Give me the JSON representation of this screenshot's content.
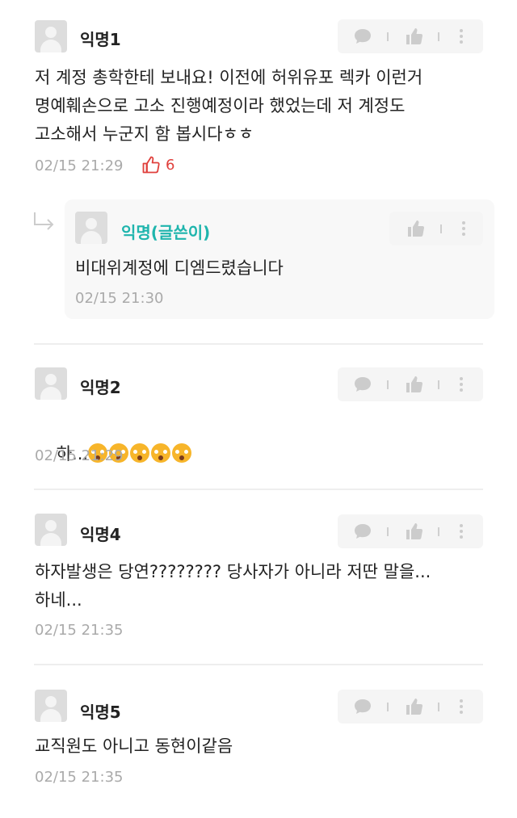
{
  "comments": [
    {
      "author": "익명1",
      "lines": [
        "저 계정 총학한테 보내요! 이전에 허위유포 렉카 이런거",
        "명예훼손으로 고소 진행예정이라 했었는데 저 계정도",
        "고소해서 누군지 함 봅시다ㅎㅎ"
      ],
      "time": "02/15 21:29",
      "likes": "6"
    },
    {
      "author": "익명(글쓴이)",
      "lines": [
        "비대위계정에 디엠드렸습니다"
      ],
      "time": "02/15 21:30"
    },
    {
      "author": "익명2",
      "lines": [
        "하..."
      ],
      "time": "02/15 21:29"
    },
    {
      "author": "익명4",
      "lines": [
        "하자발생은 당연???????? 당사자가 아니라 저딴 말을...",
        "하네..."
      ],
      "time": "02/15 21:35"
    },
    {
      "author": "익명5",
      "lines": [
        "교직원도 아니고 동현이같음"
      ],
      "time": "02/15 21:35"
    }
  ],
  "icons": {
    "comment": "speech-bubble-icon",
    "like": "thumbs-up-icon",
    "more": "more-vertical-icon",
    "reply": "reply-arrow-icon",
    "emoji": "astonished-face-emoji"
  },
  "colors": {
    "writer": "#1fb5ad",
    "like": "#e0403c",
    "muted": "#aaaaaa",
    "icon": "#cccccc"
  }
}
